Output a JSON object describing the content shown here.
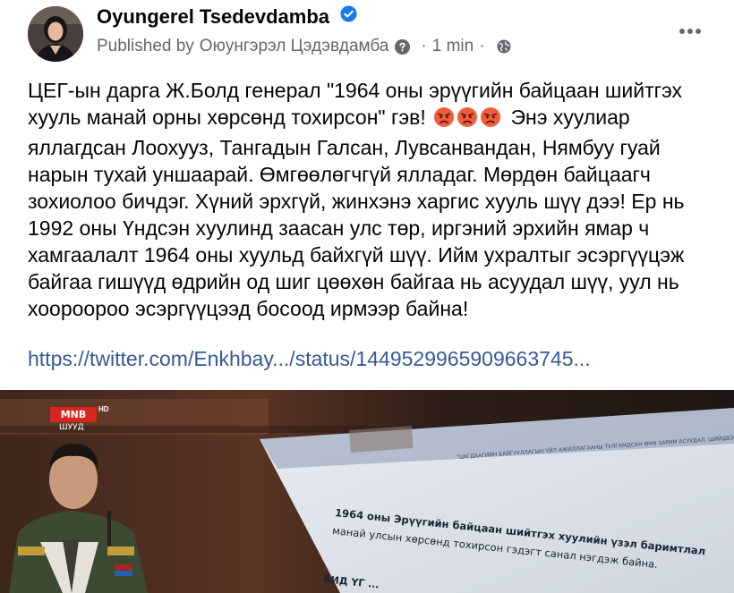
{
  "post": {
    "author_name": "Oyungerel Tsedevdamba",
    "published_prefix": "Published by",
    "published_by": "Оюунгэрэл Цэдэвдамба",
    "separator": "·",
    "time": "1 min",
    "separator2": "·",
    "verified_icon": "verified-badge-icon",
    "help_icon": "question-circle-icon",
    "audience_icon": "globe-icon",
    "more_icon": "more-horizontal-icon",
    "text_part1": "ЦЕГ-ын дарга Ж.Болд генерал \"1964 оны эрүүгийн байцаан шийтгэх хууль манай орны хөрсөнд тохирсон\" гэв!",
    "text_part2": "Энэ хуулиар яллагдсан Лоохууз, Тангадын Галсан, Лувсанвандан, Нямбуу гуай нарын тухай уншаарай. Өмгөөлөгчгүй ялладаг. Мөрдөн байцаагч зохиолоо бичдэг. Хүний эрхгүй, жинхэнэ харгис хууль шүү дээ! Ер нь 1992 оны Үндсэн хуулинд заасан улс төр, иргэний эрхийн ямар ч хамгаалалт 1964 оны хуульд байхгүй шүү. Ийм ухралтыг эсэргүүцэж байгаа гишүүд өдрийн од шиг цөөхөн байгаа нь асуудал шүү, уул нь хоороороо эсэргүүцээд босоод ирмээр байна!",
    "emoji_icon": "angry-face-icon",
    "link_text": "https://twitter.com/Enkhbay.../status/1449529965909663745..."
  },
  "video": {
    "channel_logo": "MNB",
    "logo_hd": "HD",
    "live_label": "ШУУД",
    "slide_header": "\"ЦАГДААГИЙН БАЙГУУЛЛАГЫН ҮЙЛ АЖИЛЛАГААНЫ ТУЛГАМДСАН ӨНӨ ЗАРИМ АСУУДАЛ, ШИЙДВЭРЛЭХ АРГА ЗАМ\"",
    "slide_line1": "1964 оны Эрүүгийн байцаан шийтгэх хуулийн үзэл баримтлал",
    "slide_line2": "манай улсын хөрсөнд тохирсон гэдэгт санал нэгдэж байна.",
    "slide_line3": "БИД ҮГ ..."
  }
}
